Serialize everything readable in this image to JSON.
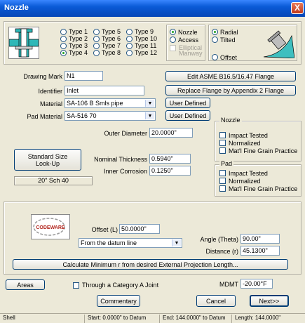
{
  "window": {
    "title": "Nozzle",
    "close": "X"
  },
  "types": [
    "Type 1",
    "Type 2",
    "Type 3",
    "Type 4",
    "Type 5",
    "Type 6",
    "Type 7",
    "Type 8",
    "Type 9",
    "Type 10",
    "Type 11",
    "Type 12"
  ],
  "selected_type": "Type 4",
  "kind": {
    "nozzle": "Nozzle",
    "access": "Access",
    "manway": "Elliptical Manway"
  },
  "orient": {
    "radial": "Radial",
    "tilted": "Tilted",
    "offset": "Offset"
  },
  "form": {
    "drawing_mark_label": "Drawing Mark",
    "drawing_mark": "N1",
    "identifier_label": "Identifier",
    "identifier": "Inlet",
    "material_label": "Material",
    "material": "SA-106 B Smls pipe",
    "pad_material_label": "Pad Material",
    "pad_material": "SA-516 70",
    "edit_flange": "Edit ASME B16.5/16.47 Flange",
    "replace_flange": "Replace Flange by Appendix 2 Flange",
    "user_defined_1": "User Defined",
    "user_defined_2": "User Defined"
  },
  "dims": {
    "outer_diameter_label": "Outer Diameter",
    "outer_diameter": "20.0000\"",
    "nominal_thickness_label": "Nominal Thickness",
    "nominal_thickness": "0.5940\"",
    "inner_corrosion_label": "Inner Corrosion",
    "inner_corrosion": "0.1250\"",
    "standard_size": "Standard Size Look-Up",
    "size_display": "20\" Sch 40"
  },
  "nozzle_group": {
    "title": "Nozzle",
    "impact": "Impact Tested",
    "normalized": "Normalized",
    "fine_grain": "Mat'l Fine Grain Practice"
  },
  "pad_group": {
    "title": "Pad",
    "impact": "Impact Tested",
    "normalized": "Normalized",
    "fine_grain": "Mat'l Fine Grain Practice"
  },
  "location": {
    "logo": "CODEWARE",
    "offset_label": "Offset (L)",
    "offset": "50.0000\"",
    "datum": "From the datum line",
    "angle_label": "Angle (Theta)",
    "angle": "90.00\"",
    "distance_label": "Distance (r)",
    "distance": "45.1300\"",
    "calc_button": "Calculate Minimum r from desired External Projection Length..."
  },
  "bottom": {
    "areas": "Areas",
    "through_joint": "Through a Category A Joint",
    "mdmt_label": "MDMT",
    "mdmt": "-20.00°F",
    "commentary": "Commentary",
    "cancel": "Cancel",
    "next": "Next>>"
  },
  "status": {
    "shell": "Shell",
    "start": "Start: 0.0000\" to Datum",
    "end": "End: 144.0000\" to Datum",
    "length": "Length: 144.0000\""
  }
}
